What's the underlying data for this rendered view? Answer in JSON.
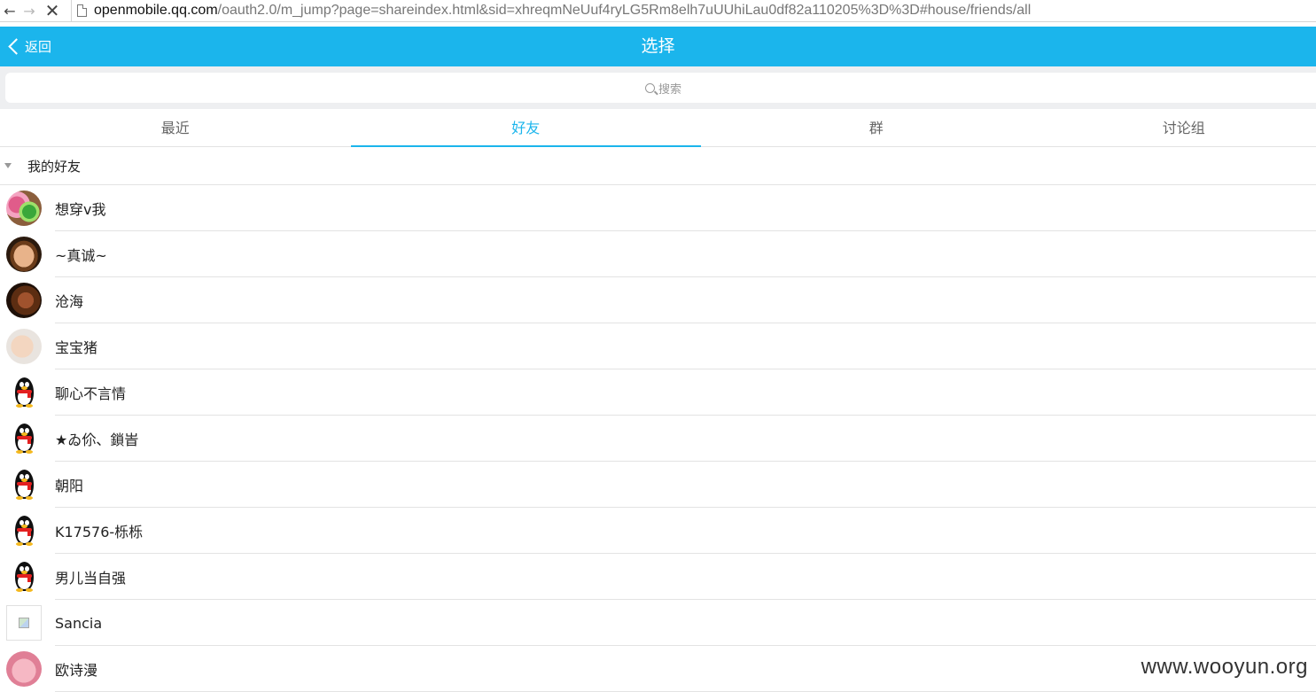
{
  "browser": {
    "url_host": "openmobile.qq.com",
    "url_rest": "/oauth2.0/m_jump?page=shareindex.html&sid=xhreqmNeUuf4ryLG5Rm8elh7uUUhiLau0df82a110205%3D%3D#house/friends/all",
    "back_icon": "←",
    "forward_icon": "→",
    "stop_icon": "✕"
  },
  "header": {
    "back_label": "返回",
    "title": "选择",
    "bg_color": "#1bb5ec"
  },
  "search": {
    "placeholder": "搜索"
  },
  "tabs": [
    {
      "label": "最近",
      "active": false
    },
    {
      "label": "好友",
      "active": true
    },
    {
      "label": "群",
      "active": false
    },
    {
      "label": "讨论组",
      "active": false
    }
  ],
  "group": {
    "label": "我的好友",
    "expanded": true
  },
  "friends": [
    {
      "name": "想穿v我",
      "avatar": "photo"
    },
    {
      "name": "~真诚~",
      "avatar": "photo"
    },
    {
      "name": "沧海",
      "avatar": "photo"
    },
    {
      "name": "宝宝猪",
      "avatar": "photo"
    },
    {
      "name": "聊心不言情",
      "avatar": "qq-penguin-icon"
    },
    {
      "name": "★ゐ伱、鎖峕",
      "avatar": "qq-penguin-icon"
    },
    {
      "name": "朝阳",
      "avatar": "qq-penguin-icon"
    },
    {
      "name": "K17576-栎栎",
      "avatar": "qq-penguin-icon"
    },
    {
      "name": "男儿当自强",
      "avatar": "qq-penguin-icon"
    },
    {
      "name": "Sancia",
      "avatar": "broken-image-icon"
    },
    {
      "name": "欧诗漫",
      "avatar": "photo"
    }
  ],
  "watermark": "www.wooyun.org"
}
